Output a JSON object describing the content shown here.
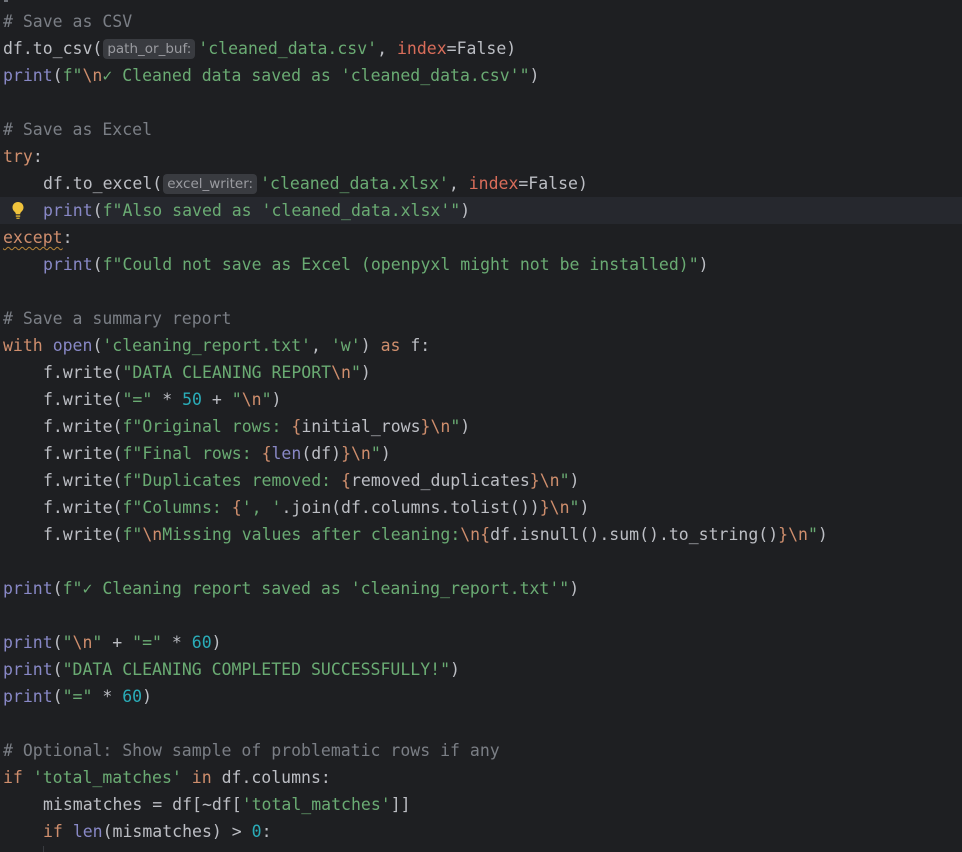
{
  "editor": {
    "language": "python",
    "current_line_index": 7,
    "lines": [
      {
        "indent": 0,
        "tokens": [
          {
            "t": "# Save as CSV",
            "c": "comment"
          }
        ]
      },
      {
        "indent": 0,
        "tokens": [
          {
            "t": "df.to_csv(",
            "c": "plain"
          },
          {
            "t": "path_or_buf:",
            "c": "inlay"
          },
          {
            "t": "'cleaned_data.csv'",
            "c": "str"
          },
          {
            "t": ", ",
            "c": "plain"
          },
          {
            "t": "index",
            "c": "param"
          },
          {
            "t": "=False)",
            "c": "plain"
          }
        ]
      },
      {
        "indent": 0,
        "tokens": [
          {
            "t": "print",
            "c": "builtin"
          },
          {
            "t": "(",
            "c": "plain"
          },
          {
            "t": "f\"",
            "c": "str"
          },
          {
            "t": "\\n",
            "c": "esc"
          },
          {
            "t": "✓ Cleaned data saved as 'cleaned_data.csv'\"",
            "c": "str"
          },
          {
            "t": ")",
            "c": "plain"
          }
        ]
      },
      {
        "indent": 0,
        "tokens": []
      },
      {
        "indent": 0,
        "tokens": [
          {
            "t": "# Save as Excel",
            "c": "comment"
          }
        ]
      },
      {
        "indent": 0,
        "tokens": [
          {
            "t": "try",
            "c": "kw"
          },
          {
            "t": ":",
            "c": "plain"
          }
        ]
      },
      {
        "indent": 1,
        "tokens": [
          {
            "t": "df.to_excel(",
            "c": "plain"
          },
          {
            "t": "excel_writer:",
            "c": "inlay"
          },
          {
            "t": "'cleaned_data.xlsx'",
            "c": "str"
          },
          {
            "t": ", ",
            "c": "plain"
          },
          {
            "t": "index",
            "c": "param"
          },
          {
            "t": "=False)",
            "c": "plain"
          }
        ]
      },
      {
        "indent": 1,
        "bulb": true,
        "tokens": [
          {
            "t": "print",
            "c": "builtin"
          },
          {
            "t": "(",
            "c": "plain"
          },
          {
            "t": "f\"Also saved as 'cleaned_data.xlsx'\"",
            "c": "str"
          },
          {
            "t": ")",
            "c": "plain"
          }
        ]
      },
      {
        "indent": 0,
        "tokens": [
          {
            "t": "except",
            "c": "kw-squiggle"
          },
          {
            "t": ":",
            "c": "plain"
          }
        ]
      },
      {
        "indent": 1,
        "tokens": [
          {
            "t": "print",
            "c": "builtin"
          },
          {
            "t": "(",
            "c": "plain"
          },
          {
            "t": "f\"Could not save as Excel (openpyxl might not be installed)\"",
            "c": "str"
          },
          {
            "t": ")",
            "c": "plain"
          }
        ]
      },
      {
        "indent": 0,
        "tokens": []
      },
      {
        "indent": 0,
        "tokens": [
          {
            "t": "# Save a summary report",
            "c": "comment"
          }
        ]
      },
      {
        "indent": 0,
        "tokens": [
          {
            "t": "with",
            "c": "kw"
          },
          {
            "t": " ",
            "c": "plain"
          },
          {
            "t": "open",
            "c": "builtin"
          },
          {
            "t": "(",
            "c": "plain"
          },
          {
            "t": "'cleaning_report.txt'",
            "c": "str"
          },
          {
            "t": ", ",
            "c": "plain"
          },
          {
            "t": "'w'",
            "c": "str"
          },
          {
            "t": ") ",
            "c": "plain"
          },
          {
            "t": "as",
            "c": "kw"
          },
          {
            "t": " f:",
            "c": "plain"
          }
        ]
      },
      {
        "indent": 1,
        "tokens": [
          {
            "t": "f.write(",
            "c": "plain"
          },
          {
            "t": "\"DATA CLEANING REPORT",
            "c": "str"
          },
          {
            "t": "\\n",
            "c": "esc"
          },
          {
            "t": "\"",
            "c": "str"
          },
          {
            "t": ")",
            "c": "plain"
          }
        ]
      },
      {
        "indent": 1,
        "tokens": [
          {
            "t": "f.write(",
            "c": "plain"
          },
          {
            "t": "\"=\"",
            "c": "str"
          },
          {
            "t": " * ",
            "c": "plain"
          },
          {
            "t": "50",
            "c": "num"
          },
          {
            "t": " + ",
            "c": "plain"
          },
          {
            "t": "\"",
            "c": "str"
          },
          {
            "t": "\\n",
            "c": "esc"
          },
          {
            "t": "\"",
            "c": "str"
          },
          {
            "t": ")",
            "c": "plain"
          }
        ]
      },
      {
        "indent": 1,
        "tokens": [
          {
            "t": "f.write(",
            "c": "plain"
          },
          {
            "t": "f\"Original rows: ",
            "c": "str"
          },
          {
            "t": "{",
            "c": "esc"
          },
          {
            "t": "initial_rows",
            "c": "plain"
          },
          {
            "t": "}",
            "c": "esc"
          },
          {
            "t": "\\n",
            "c": "esc"
          },
          {
            "t": "\"",
            "c": "str"
          },
          {
            "t": ")",
            "c": "plain"
          }
        ]
      },
      {
        "indent": 1,
        "tokens": [
          {
            "t": "f.write(",
            "c": "plain"
          },
          {
            "t": "f\"Final rows: ",
            "c": "str"
          },
          {
            "t": "{",
            "c": "esc"
          },
          {
            "t": "len",
            "c": "builtin"
          },
          {
            "t": "(df)",
            "c": "plain"
          },
          {
            "t": "}",
            "c": "esc"
          },
          {
            "t": "\\n",
            "c": "esc"
          },
          {
            "t": "\"",
            "c": "str"
          },
          {
            "t": ")",
            "c": "plain"
          }
        ]
      },
      {
        "indent": 1,
        "tokens": [
          {
            "t": "f.write(",
            "c": "plain"
          },
          {
            "t": "f\"Duplicates removed: ",
            "c": "str"
          },
          {
            "t": "{",
            "c": "esc"
          },
          {
            "t": "removed_duplicates",
            "c": "plain"
          },
          {
            "t": "}",
            "c": "esc"
          },
          {
            "t": "\\n",
            "c": "esc"
          },
          {
            "t": "\"",
            "c": "str"
          },
          {
            "t": ")",
            "c": "plain"
          }
        ]
      },
      {
        "indent": 1,
        "tokens": [
          {
            "t": "f.write(",
            "c": "plain"
          },
          {
            "t": "f\"Columns: ",
            "c": "str"
          },
          {
            "t": "{",
            "c": "esc"
          },
          {
            "t": "', '",
            "c": "str"
          },
          {
            "t": ".join(df.columns.tolist())",
            "c": "plain"
          },
          {
            "t": "}",
            "c": "esc"
          },
          {
            "t": "\\n",
            "c": "esc"
          },
          {
            "t": "\"",
            "c": "str"
          },
          {
            "t": ")",
            "c": "plain"
          }
        ]
      },
      {
        "indent": 1,
        "tokens": [
          {
            "t": "f.write(",
            "c": "plain"
          },
          {
            "t": "f\"",
            "c": "str"
          },
          {
            "t": "\\n",
            "c": "esc"
          },
          {
            "t": "Missing values after cleaning:",
            "c": "str"
          },
          {
            "t": "\\n",
            "c": "esc"
          },
          {
            "t": "{",
            "c": "esc"
          },
          {
            "t": "df.isnull().sum().to_string()",
            "c": "plain"
          },
          {
            "t": "}",
            "c": "esc"
          },
          {
            "t": "\\n",
            "c": "esc"
          },
          {
            "t": "\"",
            "c": "str"
          },
          {
            "t": ")",
            "c": "plain"
          }
        ]
      },
      {
        "indent": 0,
        "tokens": []
      },
      {
        "indent": 0,
        "tokens": [
          {
            "t": "print",
            "c": "builtin"
          },
          {
            "t": "(",
            "c": "plain"
          },
          {
            "t": "f\"✓ Cleaning report saved as 'cleaning_report.txt'\"",
            "c": "str"
          },
          {
            "t": ")",
            "c": "plain"
          }
        ]
      },
      {
        "indent": 0,
        "tokens": []
      },
      {
        "indent": 0,
        "tokens": [
          {
            "t": "print",
            "c": "builtin"
          },
          {
            "t": "(",
            "c": "plain"
          },
          {
            "t": "\"",
            "c": "str"
          },
          {
            "t": "\\n",
            "c": "esc"
          },
          {
            "t": "\"",
            "c": "str"
          },
          {
            "t": " + ",
            "c": "plain"
          },
          {
            "t": "\"=\"",
            "c": "str"
          },
          {
            "t": " * ",
            "c": "plain"
          },
          {
            "t": "60",
            "c": "num"
          },
          {
            "t": ")",
            "c": "plain"
          }
        ]
      },
      {
        "indent": 0,
        "tokens": [
          {
            "t": "print",
            "c": "builtin"
          },
          {
            "t": "(",
            "c": "plain"
          },
          {
            "t": "\"DATA CLEANING COMPLETED SUCCESSFULLY!\"",
            "c": "str"
          },
          {
            "t": ")",
            "c": "plain"
          }
        ]
      },
      {
        "indent": 0,
        "tokens": [
          {
            "t": "print",
            "c": "builtin"
          },
          {
            "t": "(",
            "c": "plain"
          },
          {
            "t": "\"=\"",
            "c": "str"
          },
          {
            "t": " * ",
            "c": "plain"
          },
          {
            "t": "60",
            "c": "num"
          },
          {
            "t": ")",
            "c": "plain"
          }
        ]
      },
      {
        "indent": 0,
        "tokens": []
      },
      {
        "indent": 0,
        "tokens": [
          {
            "t": "# Optional: Show sample of problematic rows if any",
            "c": "comment"
          }
        ]
      },
      {
        "indent": 0,
        "tokens": [
          {
            "t": "if",
            "c": "kw"
          },
          {
            "t": " ",
            "c": "plain"
          },
          {
            "t": "'total_matches'",
            "c": "str"
          },
          {
            "t": " ",
            "c": "plain"
          },
          {
            "t": "in",
            "c": "kw"
          },
          {
            "t": " df.columns:",
            "c": "plain"
          }
        ]
      },
      {
        "indent": 1,
        "tokens": [
          {
            "t": "mismatches = df[~df[",
            "c": "plain"
          },
          {
            "t": "'total_matches'",
            "c": "str"
          },
          {
            "t": "]]",
            "c": "plain"
          }
        ]
      },
      {
        "indent": 1,
        "tokens": [
          {
            "t": "if",
            "c": "kw"
          },
          {
            "t": " ",
            "c": "plain"
          },
          {
            "t": "len",
            "c": "builtin"
          },
          {
            "t": "(mismatches) > ",
            "c": "plain"
          },
          {
            "t": "0",
            "c": "num"
          },
          {
            "t": ":",
            "c": "plain"
          }
        ]
      }
    ]
  }
}
